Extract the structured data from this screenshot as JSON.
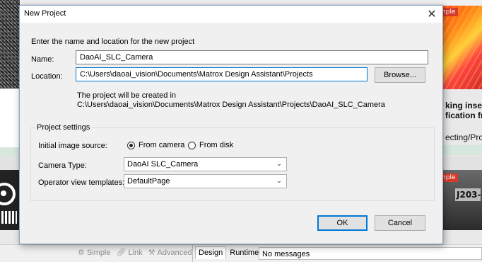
{
  "background": {
    "right_tag_label": "mple",
    "right_text_lines": [
      "king insertion",
      "fication fro",
      "ecting/Proc"
    ],
    "right_plate_text": "J203-",
    "bottom_tools": [
      {
        "icon": "gear-icon",
        "label": "Simple"
      },
      {
        "icon": "link-icon",
        "label": "Link"
      },
      {
        "icon": "tools-icon",
        "label": "Advanced"
      }
    ],
    "bottom_tabs": [
      "Design",
      "Runtime"
    ],
    "messages": "No messages"
  },
  "dialog": {
    "title": "New Project",
    "close_glyph": "✕",
    "intro": "Enter the name and location for the new project",
    "name_label": "Name:",
    "name_value": "DaoAI_SLC_Camera",
    "location_label": "Location:",
    "location_value": "C:\\Users\\daoai_vision\\Documents\\Matrox Design Assistant\\Projects",
    "browse_label": "Browse...",
    "note_line1": "The project will be created in",
    "note_line2": "C:\\Users\\daoai_vision\\Documents\\Matrox Design Assistant\\Projects\\DaoAI_SLC_Camera",
    "settings_title": "Project settings",
    "image_source_label": "Initial image source:",
    "image_source_options": [
      {
        "label": "From camera",
        "checked": true
      },
      {
        "label": "From disk",
        "checked": false
      }
    ],
    "camera_type_label": "Camera Type:",
    "camera_type_value": "DaoAI SLC_Camera",
    "templates_label": "Operator view templates:",
    "templates_value": "DefaultPage",
    "ok_label": "OK",
    "cancel_label": "Cancel"
  },
  "colors": {
    "accent": "#0078d7",
    "dialog_bg": "#f0f0f0",
    "tag_red": "#d93b2b"
  }
}
